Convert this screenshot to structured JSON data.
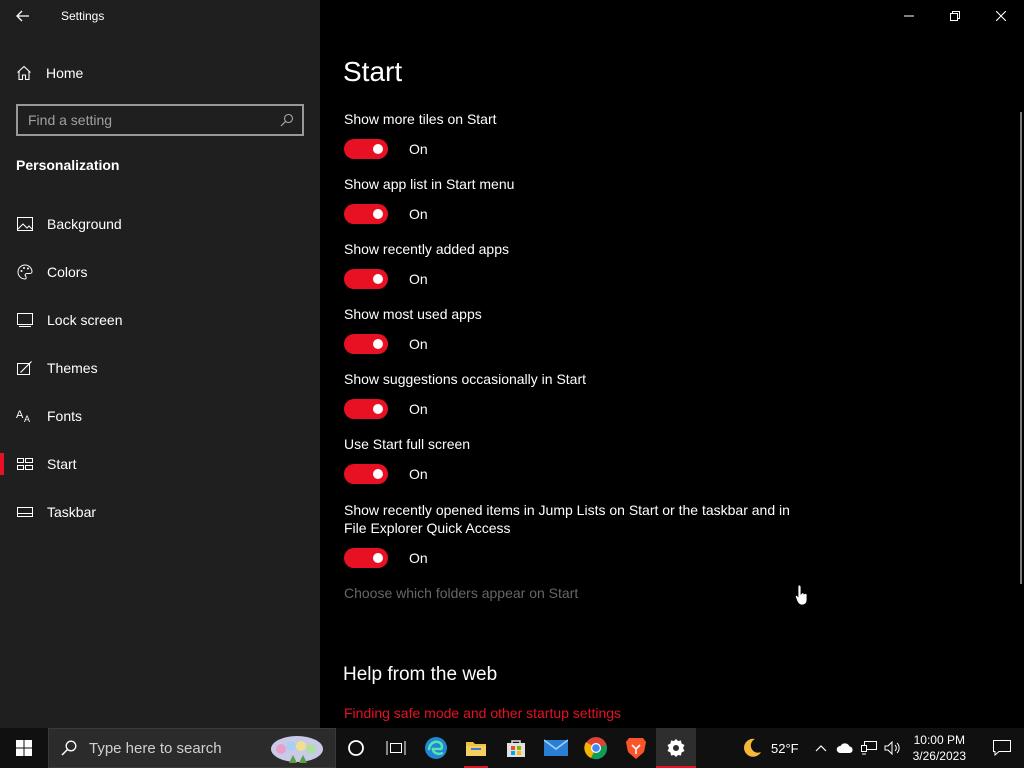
{
  "window": {
    "app_title": "Settings"
  },
  "sidebar": {
    "home_label": "Home",
    "search_placeholder": "Find a setting",
    "section_title": "Personalization",
    "items": [
      {
        "label": "Background",
        "icon": "picture-icon",
        "active": false
      },
      {
        "label": "Colors",
        "icon": "palette-icon",
        "active": false
      },
      {
        "label": "Lock screen",
        "icon": "lock-screen-icon",
        "active": false
      },
      {
        "label": "Themes",
        "icon": "themes-icon",
        "active": false
      },
      {
        "label": "Fonts",
        "icon": "fonts-icon",
        "active": false
      },
      {
        "label": "Start",
        "icon": "start-icon",
        "active": true
      },
      {
        "label": "Taskbar",
        "icon": "taskbar-icon",
        "active": false
      }
    ]
  },
  "main": {
    "title": "Start",
    "settings": [
      {
        "label": "Show more tiles on Start",
        "state": "On"
      },
      {
        "label": "Show app list in Start menu",
        "state": "On"
      },
      {
        "label": "Show recently added apps",
        "state": "On"
      },
      {
        "label": "Show most used apps",
        "state": "On"
      },
      {
        "label": "Show suggestions occasionally in Start",
        "state": "On"
      },
      {
        "label": "Use Start full screen",
        "state": "On"
      },
      {
        "label": "Show recently opened items in Jump Lists on Start or the taskbar and in File Explorer Quick Access",
        "state": "On"
      }
    ],
    "folders_link": "Choose which folders appear on Start",
    "help_title": "Help from the web",
    "help_link": "Finding safe mode and other startup settings"
  },
  "taskbar": {
    "search_placeholder": "Type here to search",
    "temperature": "52°F",
    "time": "10:00 PM",
    "date": "3/26/2023"
  },
  "colors": {
    "accent": "#e81123",
    "sidebar_bg": "#1f1f1f",
    "main_bg": "#000000"
  }
}
